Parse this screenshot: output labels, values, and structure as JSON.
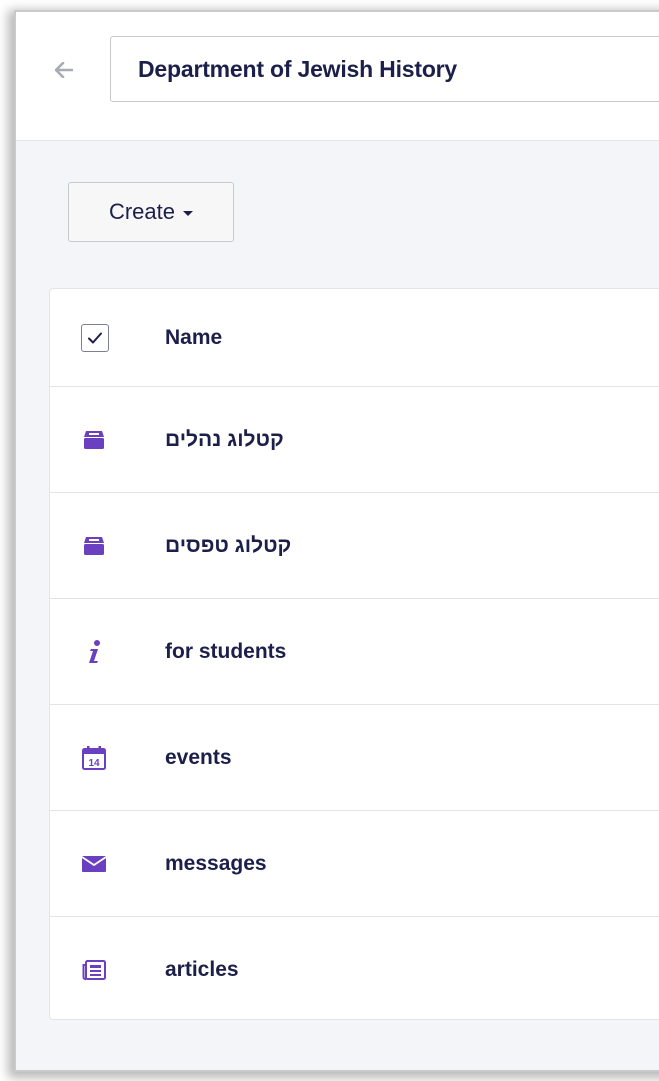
{
  "header": {
    "title": "Department of Jewish History",
    "back_icon": "arrow-left-icon"
  },
  "toolbar": {
    "create_label": "Create"
  },
  "list": {
    "column_name": "Name",
    "items": [
      {
        "label": "קטלוג נהלים",
        "icon": "archive-icon"
      },
      {
        "label": "קטלוג טפסים",
        "icon": "archive-icon"
      },
      {
        "label": "for students",
        "icon": "info-icon"
      },
      {
        "label": "events",
        "icon": "calendar-icon",
        "icon_text": "14"
      },
      {
        "label": "messages",
        "icon": "envelope-icon"
      },
      {
        "label": "articles",
        "icon": "newspaper-icon"
      }
    ]
  },
  "colors": {
    "accent": "#6a3fc0",
    "text": "#1c1f4a",
    "border": "#e3e4e8"
  }
}
